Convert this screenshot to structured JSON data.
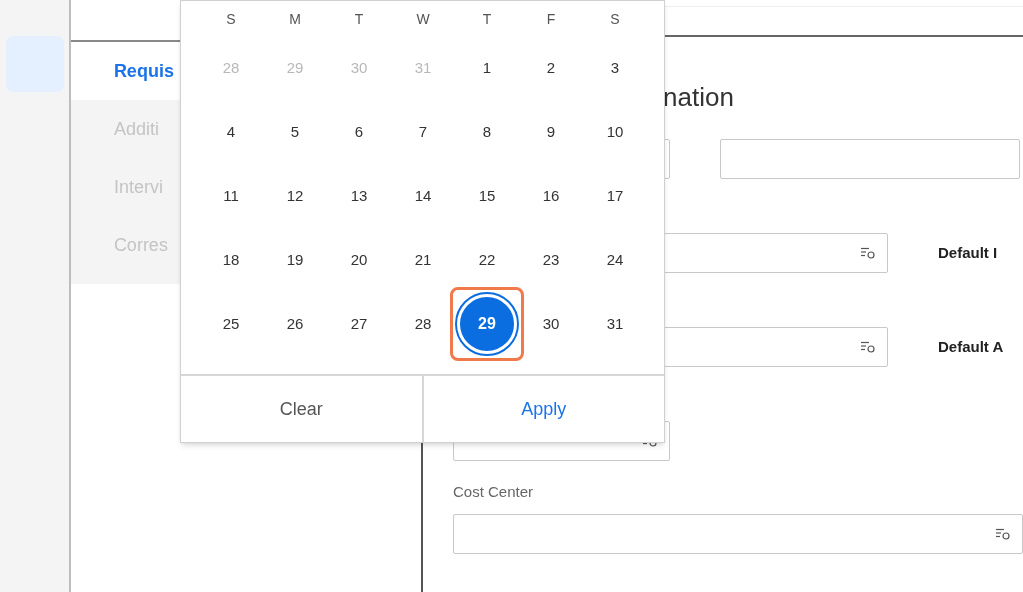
{
  "nav_items": [
    {
      "label": "Requis",
      "selected": true
    },
    {
      "label": "Additi",
      "selected": false
    },
    {
      "label": "Intervi",
      "selected": false
    },
    {
      "label": "Corres",
      "selected": false
    }
  ],
  "section_title": "nation",
  "fields": [
    {
      "label": "Default I"
    },
    {
      "label": "Default A"
    }
  ],
  "cost_center": {
    "label": "Cost Center"
  },
  "calendar": {
    "weekdays": [
      "S",
      "M",
      "T",
      "W",
      "T",
      "F",
      "S"
    ],
    "days": [
      {
        "label": "28",
        "outside": true,
        "selected": false
      },
      {
        "label": "29",
        "outside": true,
        "selected": false
      },
      {
        "label": "30",
        "outside": true,
        "selected": false
      },
      {
        "label": "31",
        "outside": true,
        "selected": false
      },
      {
        "label": "1",
        "outside": false,
        "selected": false
      },
      {
        "label": "2",
        "outside": false,
        "selected": false
      },
      {
        "label": "3",
        "outside": false,
        "selected": false
      },
      {
        "label": "4",
        "outside": false,
        "selected": false
      },
      {
        "label": "5",
        "outside": false,
        "selected": false
      },
      {
        "label": "6",
        "outside": false,
        "selected": false
      },
      {
        "label": "7",
        "outside": false,
        "selected": false
      },
      {
        "label": "8",
        "outside": false,
        "selected": false
      },
      {
        "label": "9",
        "outside": false,
        "selected": false
      },
      {
        "label": "10",
        "outside": false,
        "selected": false
      },
      {
        "label": "11",
        "outside": false,
        "selected": false
      },
      {
        "label": "12",
        "outside": false,
        "selected": false
      },
      {
        "label": "13",
        "outside": false,
        "selected": false
      },
      {
        "label": "14",
        "outside": false,
        "selected": false
      },
      {
        "label": "15",
        "outside": false,
        "selected": false
      },
      {
        "label": "16",
        "outside": false,
        "selected": false
      },
      {
        "label": "17",
        "outside": false,
        "selected": false
      },
      {
        "label": "18",
        "outside": false,
        "selected": false
      },
      {
        "label": "19",
        "outside": false,
        "selected": false
      },
      {
        "label": "20",
        "outside": false,
        "selected": false
      },
      {
        "label": "21",
        "outside": false,
        "selected": false
      },
      {
        "label": "22",
        "outside": false,
        "selected": false
      },
      {
        "label": "23",
        "outside": false,
        "selected": false
      },
      {
        "label": "24",
        "outside": false,
        "selected": false
      },
      {
        "label": "25",
        "outside": false,
        "selected": false
      },
      {
        "label": "26",
        "outside": false,
        "selected": false
      },
      {
        "label": "27",
        "outside": false,
        "selected": false
      },
      {
        "label": "28",
        "outside": false,
        "selected": false
      },
      {
        "label": "29",
        "outside": false,
        "selected": true
      },
      {
        "label": "30",
        "outside": false,
        "selected": false
      },
      {
        "label": "31",
        "outside": false,
        "selected": false
      }
    ],
    "buttons": [
      {
        "label": "Clear",
        "kind": "secondary"
      },
      {
        "label": "Apply",
        "kind": "primary"
      }
    ]
  }
}
